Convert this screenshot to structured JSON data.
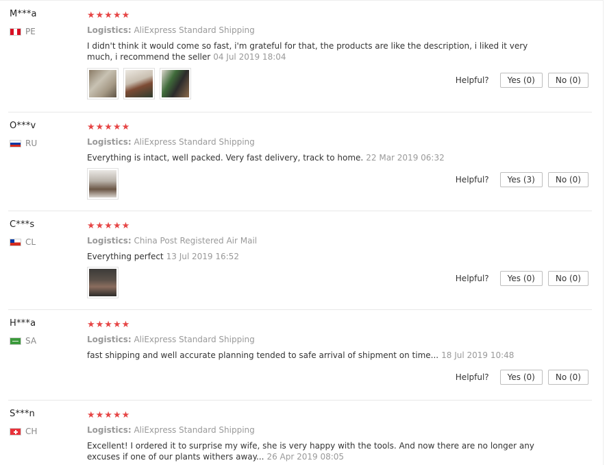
{
  "reviews": [
    {
      "buyer": "M***a",
      "country": "PE",
      "stars": "★★★★★",
      "logistics_label": "Logistics:",
      "logistics": "AliExpress Standard Shipping",
      "text": "I didn't think it would come so fast, i'm grateful for that, the products are like the description, i liked it very much, i recommend the seller",
      "date": "04 Jul 2019 18:04",
      "helpful_label": "Helpful?",
      "yes": "Yes (0)",
      "no": "No (0)"
    },
    {
      "buyer": "O***v",
      "country": "RU",
      "stars": "★★★★★",
      "logistics_label": "Logistics:",
      "logistics": "AliExpress Standard Shipping",
      "text": "Everything is intact, well packed. Very fast delivery, track to home.",
      "date": "22 Mar 2019 06:32",
      "helpful_label": "Helpful?",
      "yes": "Yes (3)",
      "no": "No (0)"
    },
    {
      "buyer": "C***s",
      "country": "CL",
      "stars": "★★★★★",
      "logistics_label": "Logistics:",
      "logistics": "China Post Registered Air Mail",
      "text": "Everything perfect",
      "date": "13 Jul 2019 16:52",
      "helpful_label": "Helpful?",
      "yes": "Yes (0)",
      "no": "No (0)"
    },
    {
      "buyer": "H***a",
      "country": "SA",
      "stars": "★★★★★",
      "logistics_label": "Logistics:",
      "logistics": "AliExpress Standard Shipping",
      "text": "fast shipping and well accurate planning tended to safe arrival of shipment on time...",
      "date": "18 Jul 2019 10:48",
      "helpful_label": "Helpful?",
      "yes": "Yes (0)",
      "no": "No (0)"
    },
    {
      "buyer": "S***n",
      "country": "CH",
      "stars": "★★★★★",
      "logistics_label": "Logistics:",
      "logistics": "AliExpress Standard Shipping",
      "text": "Excellent! I ordered it to surprise my wife, she is very happy with the tools. And now there are no longer any excuses if one of our plants withers away...",
      "date": "26 Apr 2019 08:05"
    }
  ]
}
